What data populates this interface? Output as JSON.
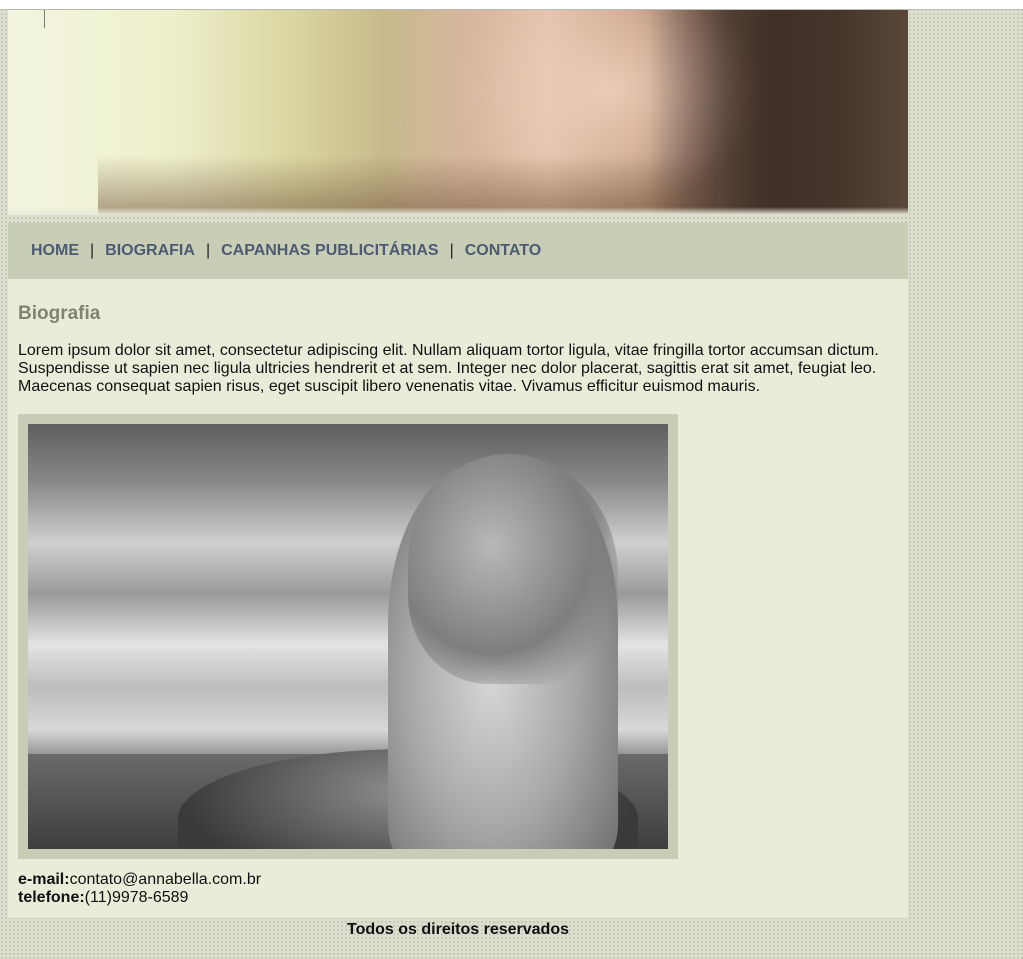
{
  "nav": {
    "items": [
      "HOME",
      "BIOGRAFIA",
      "CAPANHAS PUBLICITÁRIAS",
      "CONTATO"
    ],
    "separator": "|"
  },
  "content": {
    "heading": "Biografia",
    "paragraph": "Lorem ipsum dolor sit amet, consectetur adipiscing elit. Nullam aliquam tortor ligula, vitae fringilla tortor accumsan dictum. Suspendisse ut sapien nec ligula ultricies hendrerit et at sem. Integer nec dolor placerat, sagittis erat sit amet, feugiat leo. Maecenas consequat sapien risus, eget suscipit libero venenatis vitae. Vivamus efficitur euismod mauris."
  },
  "contact": {
    "email_label": "e-mail:",
    "email_value": "contato@annabella.com.br",
    "phone_label": "telefone:",
    "phone_value": "(11)9978-6589"
  },
  "footer": {
    "text": "Todos os direitos reservados"
  },
  "colors": {
    "page_background": "#dcdfcf",
    "nav_background": "#c8ceb6",
    "nav_link": "#4d5a73",
    "content_background": "#e8ecd9",
    "heading": "#7f8470"
  }
}
